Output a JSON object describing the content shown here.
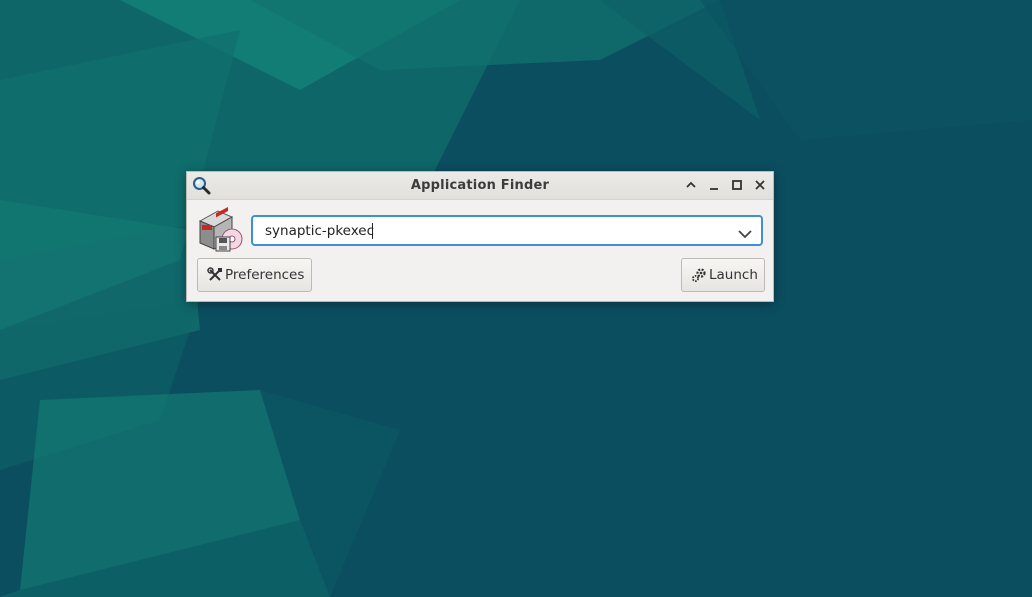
{
  "window": {
    "title": "Application Finder",
    "title_icon": "search-icon",
    "controls": [
      "shade-icon",
      "minimize-icon",
      "maximize-icon",
      "close-icon"
    ]
  },
  "app_icon": "synaptic-package-manager-icon",
  "search": {
    "value": "synaptic-pkexec"
  },
  "buttons": {
    "preferences_label": "Preferences",
    "launch_label": "Launch"
  },
  "colors": {
    "desktop": "#0b4f60",
    "focus_border": "#3d8fd8",
    "window_bg": "#f2f1ef"
  }
}
